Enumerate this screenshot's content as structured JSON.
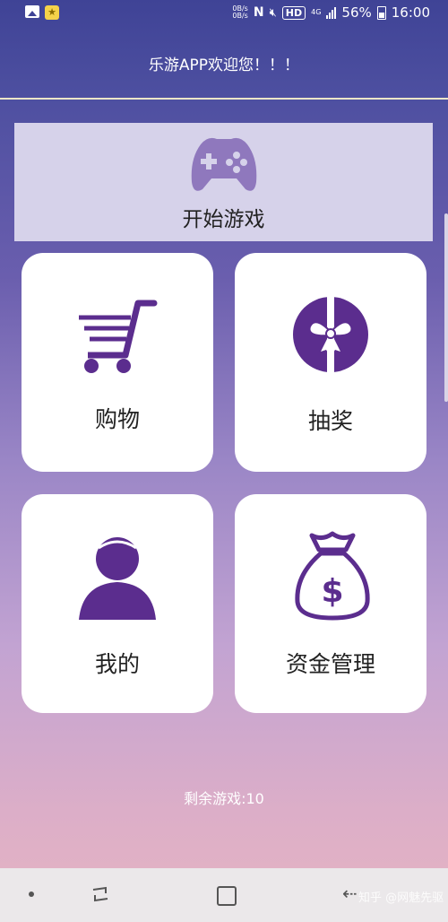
{
  "status_bar": {
    "net_speed_top": "0B/s",
    "net_speed_bottom": "0B/s",
    "hd": "HD",
    "network": "4G",
    "battery": "56%",
    "time": "16:00"
  },
  "header": {
    "title": "乐游APP欢迎您！！！"
  },
  "start_game": {
    "label": "开始游戏"
  },
  "cards": [
    {
      "label": "购物",
      "icon": "shopping-cart-icon"
    },
    {
      "label": "抽奖",
      "icon": "gift-icon"
    },
    {
      "label": "我的",
      "icon": "user-icon"
    },
    {
      "label": "资金管理",
      "icon": "money-bag-icon"
    }
  ],
  "remaining": "剩余游戏:10",
  "watermark": "知乎 @网魅先驱",
  "colors": {
    "accent": "#5b2d8e",
    "panel": "#d6d2ea"
  }
}
